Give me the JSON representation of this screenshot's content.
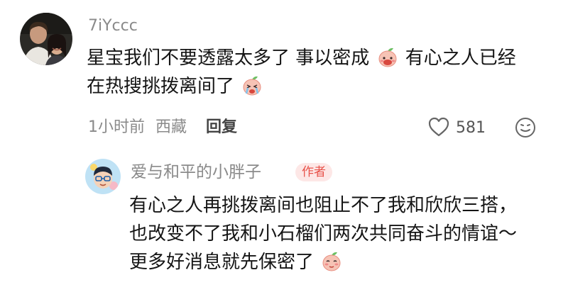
{
  "comment": {
    "username": "7iYccc",
    "text_line1_a": "星宝我们不要透露太多了 事以密成",
    "text_line1_b": "有心之人已经",
    "text_line2": "在热搜挑拨离间了",
    "time": "1小时前",
    "location": "西藏",
    "reply_label": "回复",
    "like_count": "581",
    "emoji_1": "peach-sticker-blush",
    "emoji_2": "peach-sticker-crying",
    "avatar_icon": "couple-photo-avatar"
  },
  "reply": {
    "username": "爱与和平的小胖子",
    "author_badge": "作者",
    "text_line1": "有心之人再挑拨离间也阻止不了我和欣欣三搭，",
    "text_line2": "也改变不了我和小石榴们两次共同奋斗的情谊～",
    "text_line3": "更多好消息就先保密了",
    "emoji_1": "peach-sticker-shy",
    "avatar_icon": "cartoon-boy-avatar"
  },
  "colors": {
    "username": "#8a8a8a",
    "text": "#151515",
    "badge_bg": "#fde7e6",
    "badge_text": "#e8524a"
  }
}
